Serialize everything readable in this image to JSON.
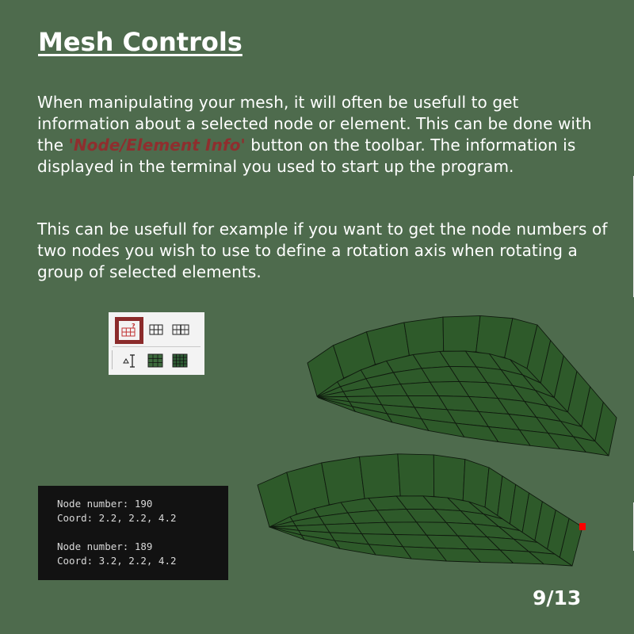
{
  "slide": {
    "title": "Mesh Controls",
    "paragraph1_before": "When manipulating your mesh, it will often be usefull to get information about a selected node or element. This can be done with the ",
    "paragraph1_highlight": "'Node/Element Info'",
    "paragraph1_after": " button on the toolbar. The information is displayed in the terminal you used to start up the program.",
    "paragraph2": "This can be usefull for example if you want to get the node numbers of two nodes you wish to use to define a rotation axis when rotating a group of selected elements.",
    "page_number": "9/13"
  },
  "toolbar": {
    "buttons": [
      {
        "icon": "node-element-info-icon",
        "selected": true
      },
      {
        "icon": "mesh-grid-icon"
      },
      {
        "icon": "mesh-split-icon"
      },
      {
        "icon": "measure-icon"
      },
      {
        "icon": "filled-grid-icon"
      },
      {
        "icon": "filled-grid-alt-icon"
      }
    ],
    "highlight_color": "#8b2b2b"
  },
  "terminal": {
    "lines": [
      "Node number: 190",
      "Coord: 2.2, 2.2, 4.2",
      "",
      "Node number: 189",
      "Coord: 3.2, 2.2, 4.2"
    ]
  },
  "colors": {
    "background": "#4e6b4d",
    "mesh_fill": "#2e5a2a",
    "mesh_edge": "#0f1a0e",
    "highlight_text": "#8f2e2e",
    "selected_node": "#ff0000"
  }
}
